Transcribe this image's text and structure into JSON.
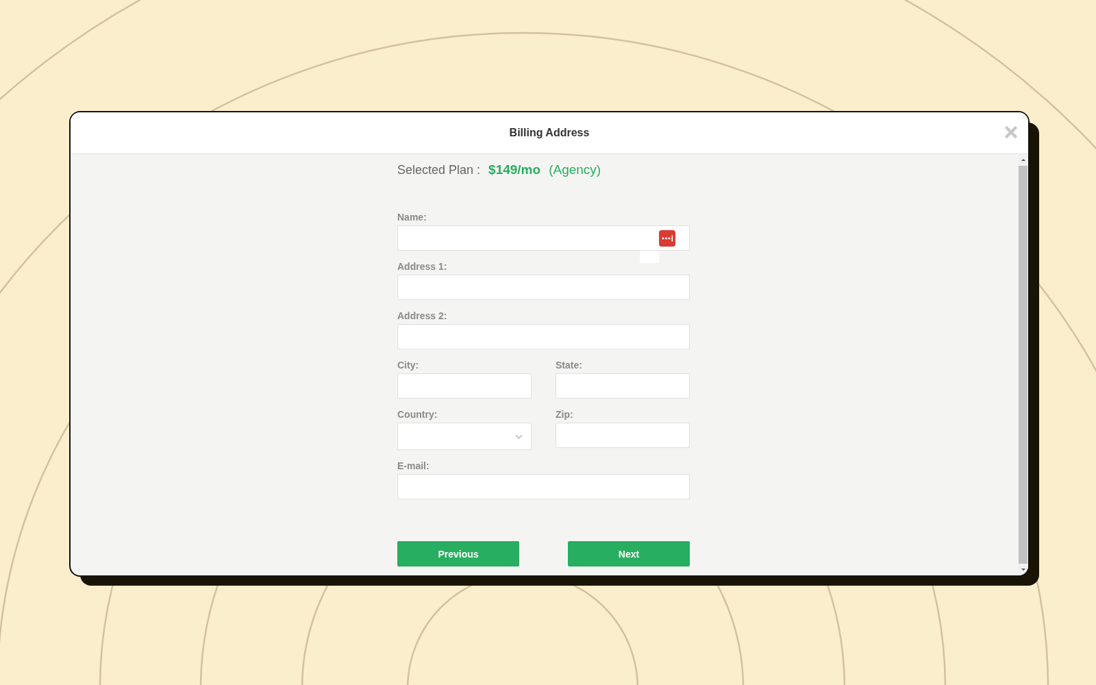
{
  "dialog": {
    "title": "Billing Address"
  },
  "plan": {
    "label": "Selected Plan :",
    "price": "$149/mo",
    "name": "(Agency)"
  },
  "form_rows": [
    [
      {
        "label": "Name:",
        "kind": "text",
        "autofill_icon": true
      }
    ],
    [
      {
        "label": "Address 1:",
        "kind": "text"
      }
    ],
    [
      {
        "label": "Address 2:",
        "kind": "text"
      }
    ],
    [
      {
        "label": "City:",
        "kind": "text"
      },
      {
        "label": "State:",
        "kind": "text"
      }
    ],
    [
      {
        "label": "Country:",
        "kind": "select"
      },
      {
        "label": "Zip:",
        "kind": "text"
      }
    ],
    [
      {
        "label": "E-mail:",
        "kind": "text"
      }
    ]
  ],
  "buttons": [
    "Previous",
    "Next"
  ]
}
